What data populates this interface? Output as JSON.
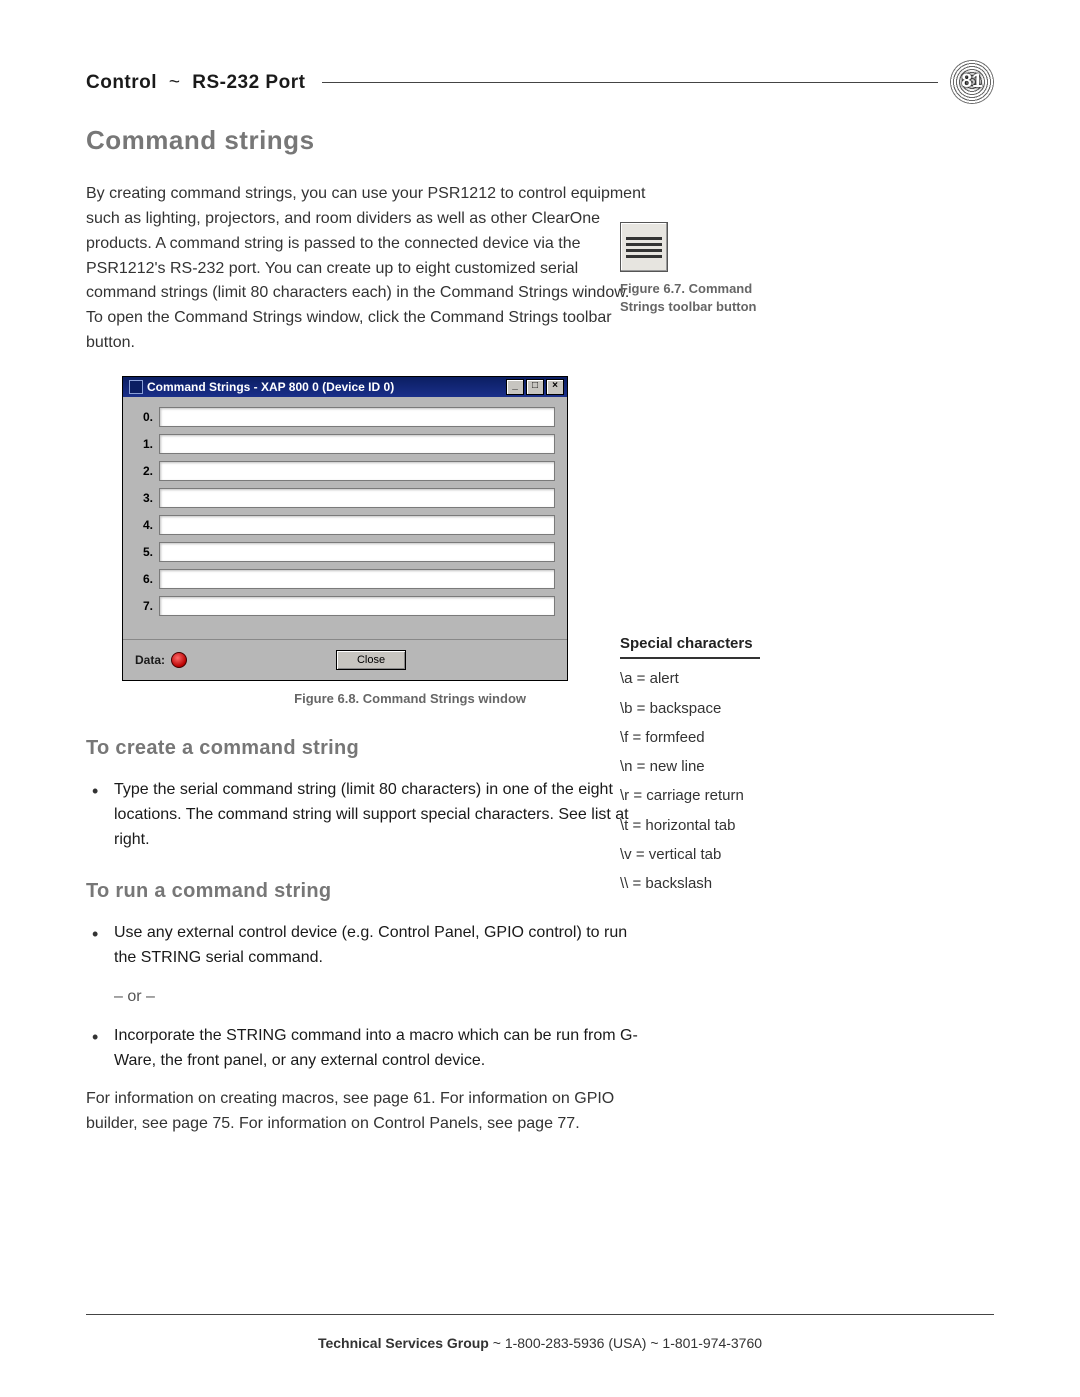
{
  "page_number": "81",
  "running_head": {
    "part1": "Control",
    "sep": "~",
    "part2": "RS-232 Port"
  },
  "section_title": "Command strings",
  "intro": "By creating command strings, you can use your PSR1212 to control equipment such as lighting, projectors, and room dividers as well as other ClearOne products. A command string is passed to the connected device via the PSR1212's RS-232 port. You can create up to eight customized serial command strings (limit 80 characters each) in the Command Strings window. To open the Command Strings window, click the Command Strings toolbar button.",
  "fig_toolbar": {
    "icon_name": "command-strings-toolbar-icon",
    "caption": "Figure 6.7. Command Strings toolbar button"
  },
  "cmd_window": {
    "title": "Command Strings - XAP 800 0 (Device ID 0)",
    "rows": [
      "0.",
      "1.",
      "2.",
      "3.",
      "4.",
      "5.",
      "6.",
      "7."
    ],
    "values": [
      "",
      "",
      "",
      "",
      "",
      "",
      "",
      ""
    ],
    "data_label": "Data:",
    "close_label": "Close",
    "caption": "Figure 6.8. Command Strings window"
  },
  "create_head": "To create a command string",
  "create_bullet": "Type the serial command string (limit 80 characters) in one of the eight locations. The command string will support special characters. See list at right.",
  "run_head": "To run a command string",
  "run_bullet1": "Use any external control device (e.g. Control Panel, GPIO control) to run the STRING serial command.",
  "or_text": "– or –",
  "run_bullet2": "Incorporate the STRING command into a macro which can be run from G-Ware, the front panel, or any external control device.",
  "more_info": "For information on creating macros, see page 61. For information on GPIO builder, see page 75. For information on Control Panels, see page 77.",
  "special": {
    "title": "Special characters",
    "items": [
      "\\a = alert",
      "\\b = backspace",
      "\\f = formfeed",
      "\\n = new line",
      "\\r = carriage return",
      "\\t = horizontal tab",
      "\\v = vertical tab",
      "\\\\ = backslash"
    ]
  },
  "footer": {
    "group": "Technical Services Group",
    "rest": " ~ 1-800-283-5936 (USA) ~ 1-801-974-3760"
  }
}
